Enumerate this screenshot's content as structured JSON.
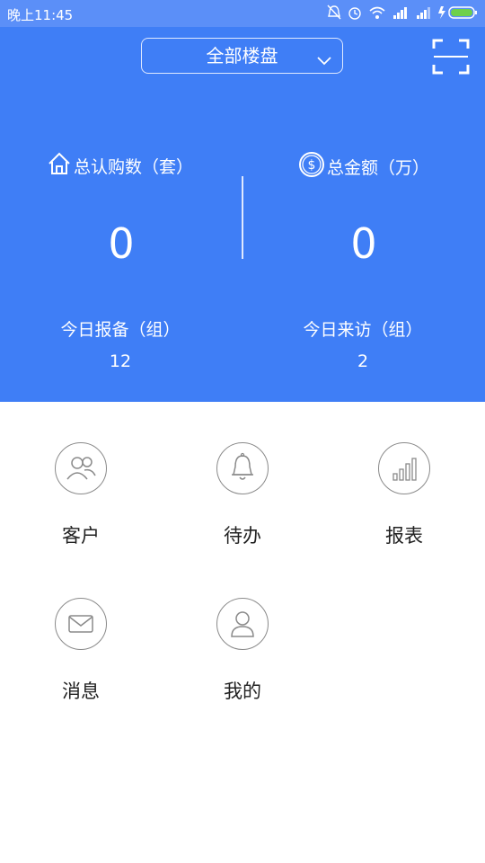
{
  "status_bar": {
    "time": "晚上11:45"
  },
  "header": {
    "project_selector": "全部楼盘",
    "stats": [
      {
        "label": "总认购数（套）",
        "value": "0",
        "icon": "house-icon"
      },
      {
        "label": "总金额（万）",
        "value": "0",
        "icon": "dollar-coin-icon"
      }
    ],
    "today": [
      {
        "label": "今日报备（组）",
        "value": "12"
      },
      {
        "label": "今日来访（组）",
        "value": "2"
      }
    ]
  },
  "menu": [
    {
      "label": "客户",
      "icon": "customers-icon"
    },
    {
      "label": "待办",
      "icon": "bell-icon"
    },
    {
      "label": "报表",
      "icon": "bar-chart-icon"
    },
    {
      "label": "消息",
      "icon": "envelope-icon"
    },
    {
      "label": "我的",
      "icon": "user-icon"
    }
  ],
  "colors": {
    "primary": "#3f7ef6",
    "status_bar": "#5b8ff8",
    "icon_stroke": "#8a8a8a"
  }
}
